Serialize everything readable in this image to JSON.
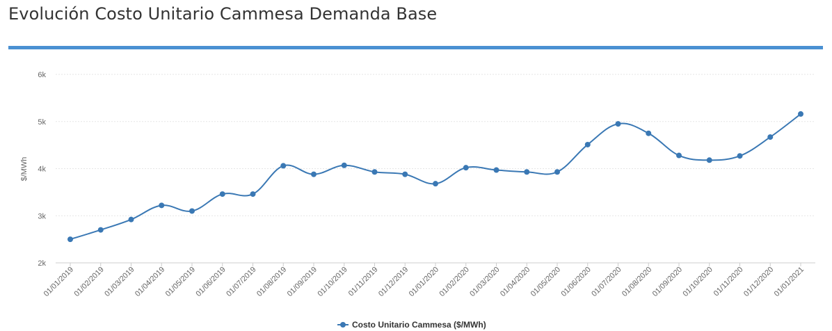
{
  "page": {
    "title": "Evolución Costo Unitario Cammesa Demanda Base"
  },
  "colors": {
    "accent_rule": "#4a90d2",
    "series": "#3a78b4",
    "gridline": "#e6e6e6",
    "text": "#333333",
    "tick_text": "#666666"
  },
  "chart_data": {
    "type": "line",
    "title": "",
    "xlabel": "",
    "ylabel": "$/MWh",
    "ylim": [
      2000,
      6000
    ],
    "yticks": [
      2000,
      3000,
      4000,
      5000,
      6000
    ],
    "ytick_labels": [
      "2k",
      "3k",
      "4k",
      "5k",
      "6k"
    ],
    "grid": true,
    "legend_position": "bottom-center",
    "smooth": true,
    "categories": [
      "01/01/2019",
      "01/02/2019",
      "01/03/2019",
      "01/04/2019",
      "01/05/2019",
      "01/06/2019",
      "01/07/2019",
      "01/08/2019",
      "01/09/2019",
      "01/10/2019",
      "01/11/2019",
      "01/12/2019",
      "01/01/2020",
      "01/02/2020",
      "01/03/2020",
      "01/04/2020",
      "01/05/2020",
      "01/06/2020",
      "01/07/2020",
      "01/08/2020",
      "01/09/2020",
      "01/10/2020",
      "01/11/2020",
      "01/12/2020",
      "01/01/2021"
    ],
    "series": [
      {
        "name": "Costo Unitario Cammesa ($/MWh)",
        "values": [
          2500,
          2700,
          2920,
          3220,
          3100,
          3460,
          3460,
          4060,
          3880,
          4070,
          3930,
          3880,
          3680,
          4020,
          3970,
          3930,
          3930,
          4510,
          4950,
          4750,
          4280,
          4180,
          4270,
          4670,
          5160
        ]
      }
    ]
  }
}
